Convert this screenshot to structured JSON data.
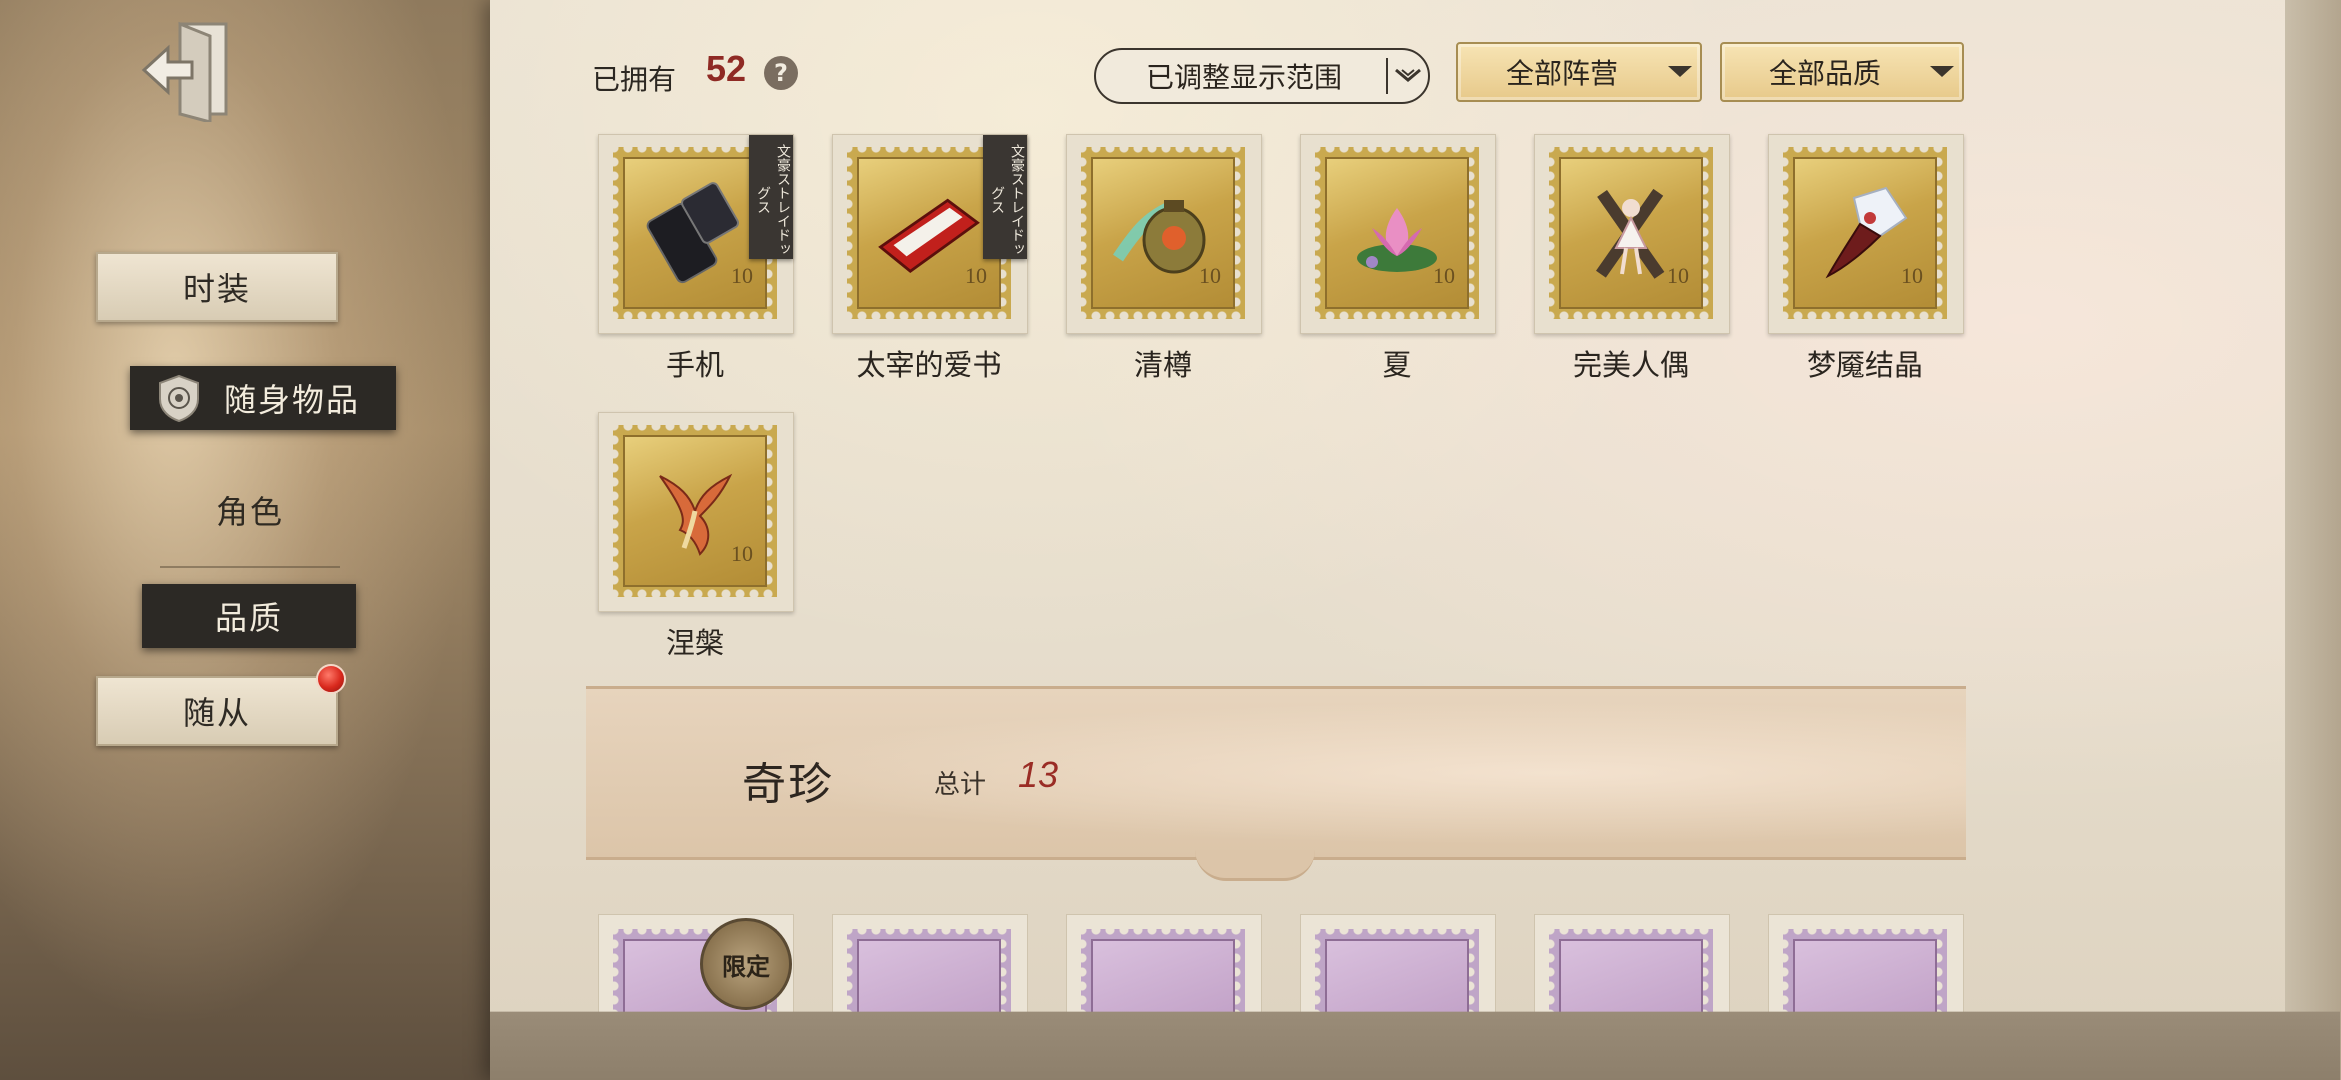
{
  "sidebar": {
    "items": [
      {
        "label": "时装"
      },
      {
        "label": "随身物品"
      },
      {
        "label": "角色"
      },
      {
        "label": "品质"
      },
      {
        "label": "随从"
      }
    ]
  },
  "header": {
    "owned_label": "已拥有",
    "owned_count": "52",
    "help": "?",
    "filters": {
      "range": "已调整显示范围",
      "faction": "全部阵营",
      "quality": "全部品质"
    }
  },
  "items": [
    {
      "name": "手机",
      "ribbon": "文豪ストレイドッグス",
      "denom": "10"
    },
    {
      "name": "太宰的爱书",
      "ribbon": "文豪ストレイドッグス",
      "denom": "10"
    },
    {
      "name": "清樽",
      "denom": "10"
    },
    {
      "name": "夏",
      "denom": "10"
    },
    {
      "name": "完美人偶",
      "denom": "10"
    },
    {
      "name": "梦魇结晶",
      "denom": "10"
    },
    {
      "name": "涅槃",
      "denom": "10"
    }
  ],
  "section": {
    "title": "奇珍",
    "total_label": "总计",
    "total": "13",
    "first_badge": "限定"
  },
  "colors": {
    "accent_red": "#9a2c25",
    "gold_stamp": "#c9a449",
    "purple_stamp": "#b996bf"
  }
}
